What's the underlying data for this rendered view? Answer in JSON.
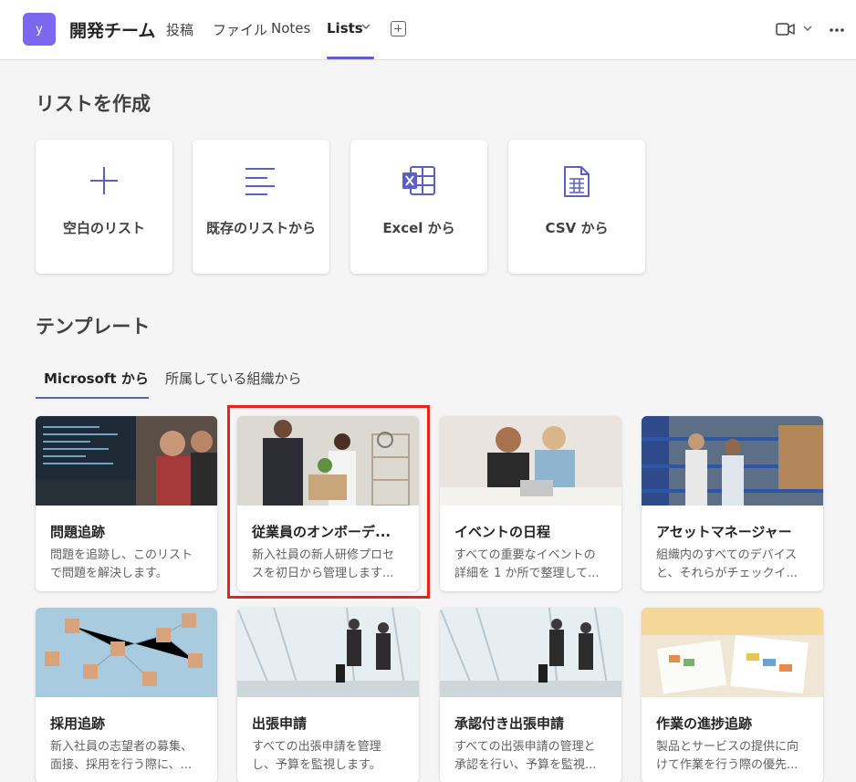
{
  "header": {
    "avatar_letter": "y",
    "team_name": "開発チーム",
    "tabs": [
      {
        "label": "投稿"
      },
      {
        "label": "ファイル"
      },
      {
        "label": "Notes"
      },
      {
        "label": "Lists"
      }
    ],
    "accent": "#5b5fc7",
    "avatar_color": "#7b68ee"
  },
  "create": {
    "title": "リストを作成",
    "cards": [
      {
        "label": "空白のリスト",
        "icon": "plus-icon"
      },
      {
        "label": "既存のリストから",
        "icon": "list-lines-icon"
      },
      {
        "label": "Excel から",
        "icon": "excel-icon"
      },
      {
        "label": "CSV から",
        "icon": "csv-file-icon"
      }
    ]
  },
  "templates": {
    "title": "テンプレート",
    "tabs": [
      {
        "label": "Microsoft から"
      },
      {
        "label": "所属している組織から"
      }
    ],
    "cards": [
      {
        "title": "問題追跡",
        "desc1": "問題を追跡し、このリスト",
        "desc2": "で問題を解決します。"
      },
      {
        "title": "従業員のオンボーデ...",
        "desc1": "新入社員の新人研修プロセ",
        "desc2": "スを初日から管理します..."
      },
      {
        "title": "イベントの日程",
        "desc1": "すべての重要なイベントの",
        "desc2": "詳細を 1 か所で整理して..."
      },
      {
        "title": "アセットマネージャー",
        "desc1": "組織内のすべてのデバイス",
        "desc2": "と、それらがチェックイ..."
      },
      {
        "title": "採用追跡",
        "desc1": "新入社員の志望者の募集、",
        "desc2": "面接、採用を行う際に、..."
      },
      {
        "title": "出張申請",
        "desc1": "すべての出張申請を管理",
        "desc2": "し、予算を監視します。"
      },
      {
        "title": "承認付き出張申請",
        "desc1": "すべての出張申請の管理と",
        "desc2": "承認を行い、予算を監視..."
      },
      {
        "title": "作業の進捗追跡",
        "desc1": "製品とサービスの提供に向",
        "desc2": "けて作業を行う際の優先..."
      }
    ]
  }
}
